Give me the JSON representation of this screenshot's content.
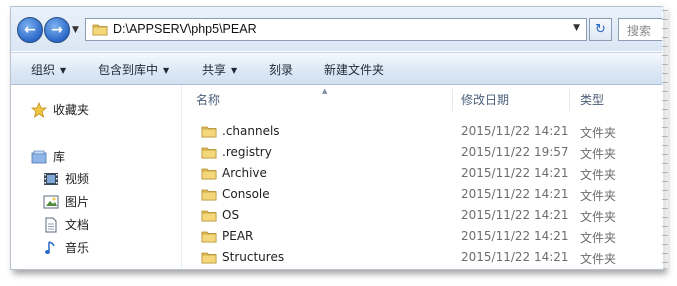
{
  "address": {
    "path": "D:\\APPSERV\\php5\\PEAR",
    "search_placeholder": "搜索"
  },
  "toolbar": {
    "organize": "组织",
    "include_in_library": "包含到库中",
    "share": "共享",
    "burn": "刻录",
    "new_folder": "新建文件夹"
  },
  "navpane": {
    "favorites": "收藏夹",
    "libraries": "库",
    "videos": "视频",
    "pictures": "图片",
    "documents": "文档",
    "music": "音乐"
  },
  "columns": {
    "name": "名称",
    "modified": "修改日期",
    "type": "类型"
  },
  "files": [
    {
      "name": ".channels",
      "date": "2015/11/22 14:21",
      "type": "文件夹"
    },
    {
      "name": ".registry",
      "date": "2015/11/22 19:57",
      "type": "文件夹"
    },
    {
      "name": "Archive",
      "date": "2015/11/22 14:21",
      "type": "文件夹"
    },
    {
      "name": "Console",
      "date": "2015/11/22 14:21",
      "type": "文件夹"
    },
    {
      "name": "OS",
      "date": "2015/11/22 14:21",
      "type": "文件夹"
    },
    {
      "name": "PEAR",
      "date": "2015/11/22 14:21",
      "type": "文件夹"
    },
    {
      "name": "Structures",
      "date": "2015/11/22 14:21",
      "type": "文件夹"
    }
  ],
  "colors": {
    "folder": "#e8c35a",
    "accent": "#2a68c8"
  }
}
